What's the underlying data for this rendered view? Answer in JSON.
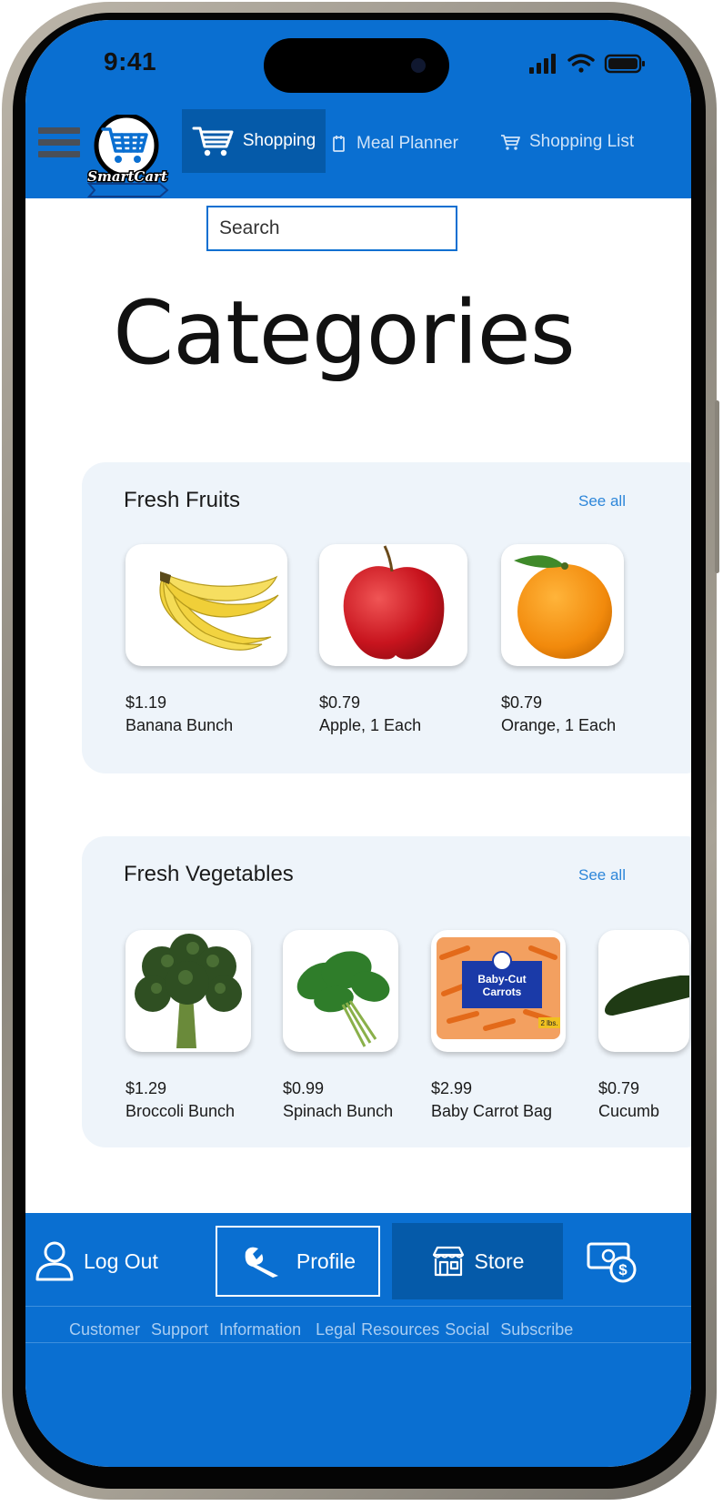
{
  "status_bar": {
    "time": "9:41"
  },
  "header": {
    "logo_text": "SmartCart",
    "tabs": [
      {
        "label": "Shopping",
        "active": true
      },
      {
        "label": "Meal Planner",
        "active": false
      },
      {
        "label": "Shopping List",
        "active": false
      }
    ]
  },
  "search": {
    "placeholder": "Search"
  },
  "page_title": "Categories",
  "categories": [
    {
      "title": "Fresh Fruits",
      "see_all": "See all",
      "items": [
        {
          "price": "$1.19",
          "name": "Banana Bunch"
        },
        {
          "price": "$0.79",
          "name": "Apple, 1 Each"
        },
        {
          "price": "$0.79",
          "name": "Orange, 1 Each"
        }
      ]
    },
    {
      "title": "Fresh Vegetables",
      "see_all": "See all",
      "items": [
        {
          "price": "$1.29",
          "name": "Broccoli Bunch"
        },
        {
          "price": "$0.99",
          "name": "Spinach Bunch"
        },
        {
          "price": "$2.99",
          "name": "Baby Carrot Bag",
          "package_text": [
            "Baby-Cut",
            "Carrots",
            "2 lbs."
          ]
        },
        {
          "price": "$0.79",
          "name": "Cucumb"
        }
      ]
    }
  ],
  "bottom_nav": {
    "logout": "Log Out",
    "profile": "Profile",
    "store": "Store"
  },
  "footer_links": [
    "Customer",
    "Support",
    "Information",
    "Legal",
    "Resources",
    "Social",
    "Subscribe"
  ],
  "colors": {
    "primary": "#0a6fd1",
    "active_tab": "#055aa9",
    "card_bg": "#eef4fa",
    "link": "#2d86d9"
  }
}
